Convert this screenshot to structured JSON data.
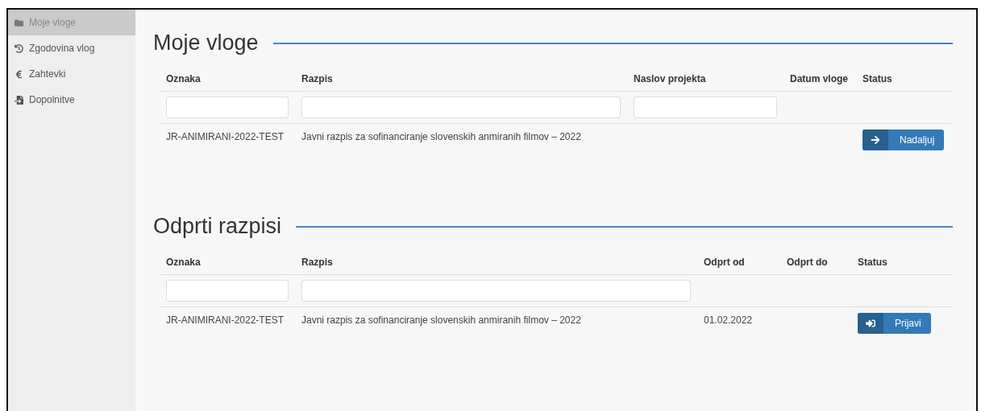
{
  "sidebar": {
    "items": [
      {
        "label": "Moje vloge",
        "kind": "folder",
        "selected": true
      },
      {
        "label": "Zgodovina vlog",
        "kind": "history",
        "selected": false
      },
      {
        "label": "Zahtevki",
        "kind": "euro",
        "selected": false
      },
      {
        "label": "Dopolnitve",
        "kind": "file",
        "selected": false
      }
    ]
  },
  "sections": [
    {
      "title": "Moje vloge",
      "table": {
        "columns": [
          {
            "label": "Oznaka",
            "filterable": true
          },
          {
            "label": "Razpis",
            "filterable": true
          },
          {
            "label": "Naslov projekta",
            "filterable": true
          },
          {
            "label": "Datum vloge",
            "filterable": false
          },
          {
            "label": "Status",
            "filterable": false
          }
        ],
        "rows": [
          {
            "cells": [
              "JR-ANIMIRANI-2022-TEST",
              "Javni razpis za sofinanciranje slovenskih anmiranih filmov – 2022",
              "",
              ""
            ],
            "action": {
              "label": "Nadaljuj",
              "kind": "continue"
            }
          }
        ]
      }
    },
    {
      "title": "Odprti razpisi",
      "table": {
        "columns": [
          {
            "label": "Oznaka",
            "filterable": true
          },
          {
            "label": "Razpis",
            "filterable": true
          },
          {
            "label": "Odprt od",
            "filterable": false
          },
          {
            "label": "Odprt do",
            "filterable": false
          },
          {
            "label": "Status",
            "filterable": false
          }
        ],
        "rows": [
          {
            "cells": [
              "JR-ANIMIRANI-2022-TEST",
              "Javni razpis za sofinanciranje slovenskih anmiranih filmov – 2022",
              "01.02.2022",
              ""
            ],
            "action": {
              "label": "Prijavi",
              "kind": "apply"
            }
          }
        ]
      }
    }
  ]
}
